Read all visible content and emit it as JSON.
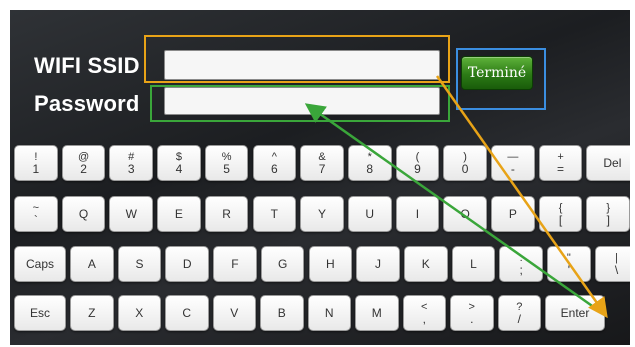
{
  "form": {
    "ssid_label": "WIFI SSID",
    "password_label": "Password",
    "ssid_value": "",
    "password_value": "",
    "done_label": "Terminé"
  },
  "annotation_colors": {
    "ssid_highlight": "#e8a317",
    "password_highlight": "#3aa63a",
    "done_highlight": "#3b8ee0"
  },
  "keyboard": {
    "row1": [
      {
        "top": "!",
        "bottom": "1"
      },
      {
        "top": "@",
        "bottom": "2"
      },
      {
        "top": "#",
        "bottom": "3"
      },
      {
        "top": "$",
        "bottom": "4"
      },
      {
        "top": "%",
        "bottom": "5"
      },
      {
        "top": "^",
        "bottom": "6"
      },
      {
        "top": "&",
        "bottom": "7"
      },
      {
        "top": "*",
        "bottom": "8"
      },
      {
        "top": "(",
        "bottom": "9"
      },
      {
        "top": ")",
        "bottom": "0"
      },
      {
        "top": "—",
        "bottom": "-"
      },
      {
        "top": "+",
        "bottom": "="
      },
      {
        "label": "Del"
      }
    ],
    "row2": [
      {
        "top": "~",
        "bottom": "`"
      },
      {
        "label": "Q"
      },
      {
        "label": "W"
      },
      {
        "label": "E"
      },
      {
        "label": "R"
      },
      {
        "label": "T"
      },
      {
        "label": "Y"
      },
      {
        "label": "U"
      },
      {
        "label": "I"
      },
      {
        "label": "O"
      },
      {
        "label": "P"
      },
      {
        "top": "{",
        "bottom": "["
      },
      {
        "top": "}",
        "bottom": "]"
      }
    ],
    "row3": [
      {
        "label": "Caps"
      },
      {
        "label": "A"
      },
      {
        "label": "S"
      },
      {
        "label": "D"
      },
      {
        "label": "F"
      },
      {
        "label": "G"
      },
      {
        "label": "H"
      },
      {
        "label": "J"
      },
      {
        "label": "K"
      },
      {
        "label": "L"
      },
      {
        "top": ":",
        "bottom": ";"
      },
      {
        "top": "\"",
        "bottom": "'"
      },
      {
        "top": "|",
        "bottom": "\\"
      }
    ],
    "row4": [
      {
        "label": "Esc"
      },
      {
        "label": "Z"
      },
      {
        "label": "X"
      },
      {
        "label": "C"
      },
      {
        "label": "V"
      },
      {
        "label": "B"
      },
      {
        "label": "N"
      },
      {
        "label": "M"
      },
      {
        "top": "<",
        "bottom": ","
      },
      {
        "top": ">",
        "bottom": "."
      },
      {
        "top": "?",
        "bottom": "/"
      },
      {
        "label": "Enter"
      }
    ]
  }
}
